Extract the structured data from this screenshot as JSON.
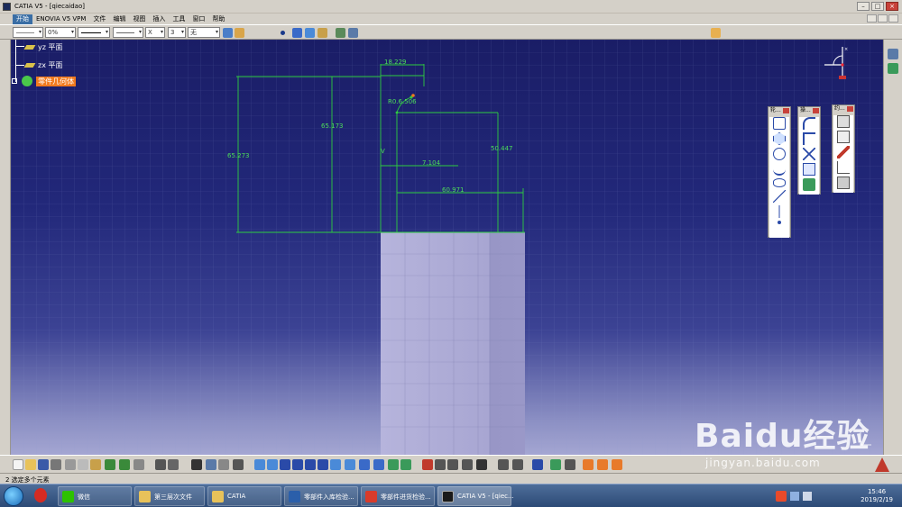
{
  "window": {
    "title": "CATIA V5 - [qiecaidao]"
  },
  "menu": {
    "items": [
      "开始",
      "ENOVIA V5 VPM",
      "文件",
      "编辑",
      "视图",
      "插入",
      "工具",
      "窗口",
      "帮助"
    ]
  },
  "toolbar": {
    "percent_value": "0%",
    "thickness_value": "3",
    "layer_value": "无",
    "x_label": "X"
  },
  "tree": {
    "items": [
      {
        "label": "yz 平面"
      },
      {
        "label": "zx 平面"
      },
      {
        "label": "零件几何体"
      }
    ]
  },
  "dimensions": {
    "d1": "18.229",
    "d2": "65.273",
    "d3": "65.173",
    "d4": "R0.6.506",
    "d5": "50.447",
    "d6": "7.104",
    "d7": "60.971",
    "v_label": "V"
  },
  "palettes": {
    "p1_title": "轮...",
    "p2_title": "操...",
    "p3_title": "约..."
  },
  "status": {
    "text": "2 选定多个元素"
  },
  "taskbar": {
    "tasks": [
      {
        "label": "微信",
        "color": "#2dc100"
      },
      {
        "label": "第三层次文件",
        "color": "#e8c25a"
      },
      {
        "label": "CATIA",
        "color": "#e8c25a"
      },
      {
        "label": "零部件入库检验...",
        "color": "#2b5faa"
      },
      {
        "label": "零部件进货检验...",
        "color": "#d83b2b"
      },
      {
        "label": "CATIA V5 - [qiec...",
        "color": "#1a1a1a"
      }
    ],
    "time": "15:46",
    "date": "2019/2/19"
  },
  "watermark": {
    "main": "Baidu经验",
    "sub": "jingyan.baidu.com"
  },
  "colors": {
    "dimension": "#2ecc40",
    "selected": "#f07a1e",
    "background_top": "#1a1d66"
  }
}
